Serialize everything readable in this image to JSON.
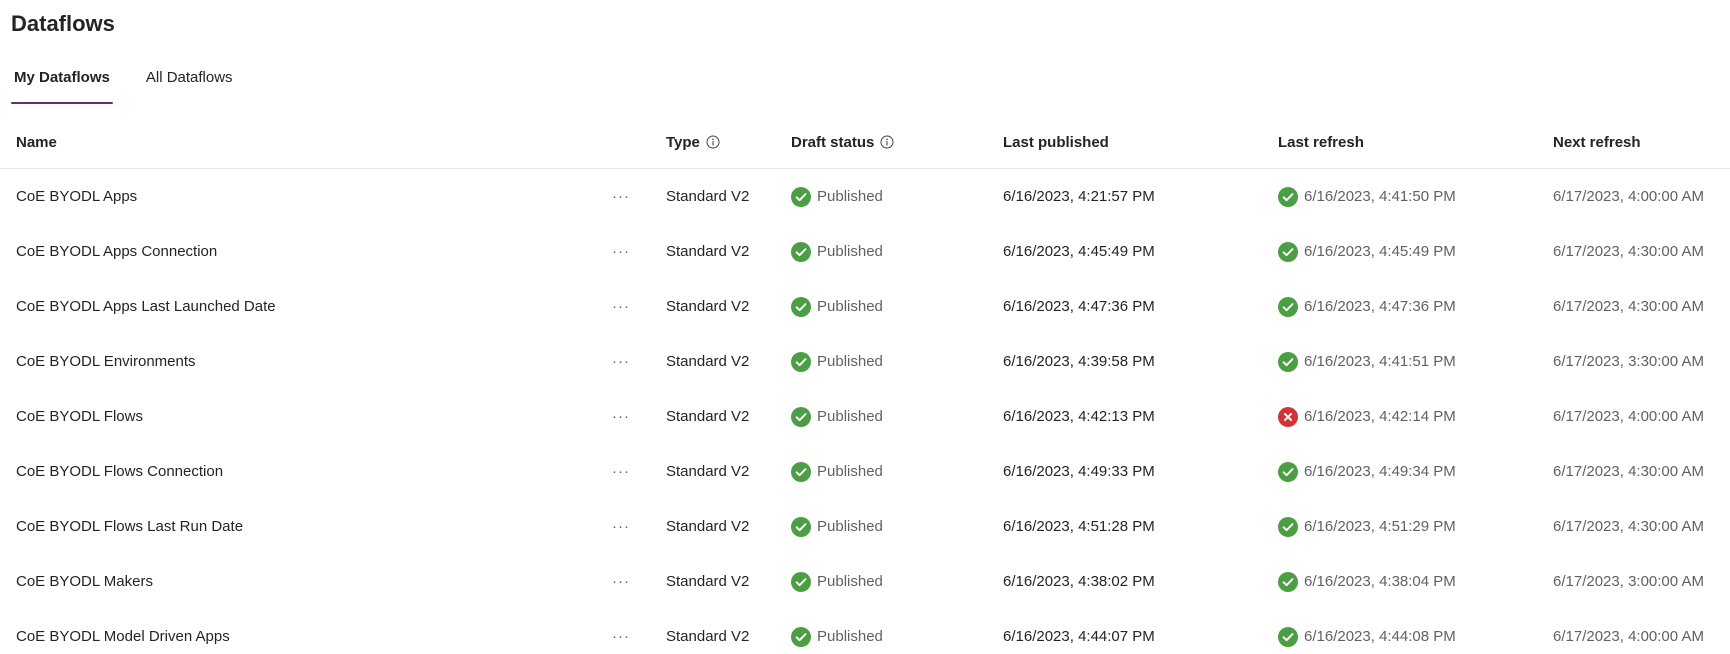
{
  "page": {
    "title": "Dataflows"
  },
  "tabs": [
    {
      "label": "My Dataflows",
      "active": true
    },
    {
      "label": "All Dataflows",
      "active": false
    }
  ],
  "columns": {
    "name": "Name",
    "type": "Type",
    "draft_status": "Draft status",
    "last_published": "Last published",
    "last_refresh": "Last refresh",
    "next_refresh": "Next refresh"
  },
  "icons": {
    "more": "more-options-icon",
    "info": "info-icon",
    "success": "success-check-icon",
    "error": "error-x-icon"
  },
  "colors": {
    "success": "#4c9e45",
    "error": "#d13438",
    "accent": "#742774"
  },
  "more_label": "···",
  "rows": [
    {
      "name": "CoE BYODL Apps",
      "type": "Standard V2",
      "draft_status": "Published",
      "last_published": "6/16/2023, 4:21:57 PM",
      "last_refresh": "6/16/2023, 4:41:50 PM",
      "last_refresh_status": "success",
      "next_refresh": "6/17/2023, 4:00:00 AM"
    },
    {
      "name": "CoE BYODL Apps Connection",
      "type": "Standard V2",
      "draft_status": "Published",
      "last_published": "6/16/2023, 4:45:49 PM",
      "last_refresh": "6/16/2023, 4:45:49 PM",
      "last_refresh_status": "success",
      "next_refresh": "6/17/2023, 4:30:00 AM"
    },
    {
      "name": "CoE BYODL Apps Last Launched Date",
      "type": "Standard V2",
      "draft_status": "Published",
      "last_published": "6/16/2023, 4:47:36 PM",
      "last_refresh": "6/16/2023, 4:47:36 PM",
      "last_refresh_status": "success",
      "next_refresh": "6/17/2023, 4:30:00 AM"
    },
    {
      "name": "CoE BYODL Environments",
      "type": "Standard V2",
      "draft_status": "Published",
      "last_published": "6/16/2023, 4:39:58 PM",
      "last_refresh": "6/16/2023, 4:41:51 PM",
      "last_refresh_status": "success",
      "next_refresh": "6/17/2023, 3:30:00 AM"
    },
    {
      "name": "CoE BYODL Flows",
      "type": "Standard V2",
      "draft_status": "Published",
      "last_published": "6/16/2023, 4:42:13 PM",
      "last_refresh": "6/16/2023, 4:42:14 PM",
      "last_refresh_status": "error",
      "next_refresh": "6/17/2023, 4:00:00 AM"
    },
    {
      "name": "CoE BYODL Flows Connection",
      "type": "Standard V2",
      "draft_status": "Published",
      "last_published": "6/16/2023, 4:49:33 PM",
      "last_refresh": "6/16/2023, 4:49:34 PM",
      "last_refresh_status": "success",
      "next_refresh": "6/17/2023, 4:30:00 AM"
    },
    {
      "name": "CoE BYODL Flows Last Run Date",
      "type": "Standard V2",
      "draft_status": "Published",
      "last_published": "6/16/2023, 4:51:28 PM",
      "last_refresh": "6/16/2023, 4:51:29 PM",
      "last_refresh_status": "success",
      "next_refresh": "6/17/2023, 4:30:00 AM"
    },
    {
      "name": "CoE BYODL Makers",
      "type": "Standard V2",
      "draft_status": "Published",
      "last_published": "6/16/2023, 4:38:02 PM",
      "last_refresh": "6/16/2023, 4:38:04 PM",
      "last_refresh_status": "success",
      "next_refresh": "6/17/2023, 3:00:00 AM"
    },
    {
      "name": "CoE BYODL Model Driven Apps",
      "type": "Standard V2",
      "draft_status": "Published",
      "last_published": "6/16/2023, 4:44:07 PM",
      "last_refresh": "6/16/2023, 4:44:08 PM",
      "last_refresh_status": "success",
      "next_refresh": "6/17/2023, 4:00:00 AM"
    }
  ]
}
